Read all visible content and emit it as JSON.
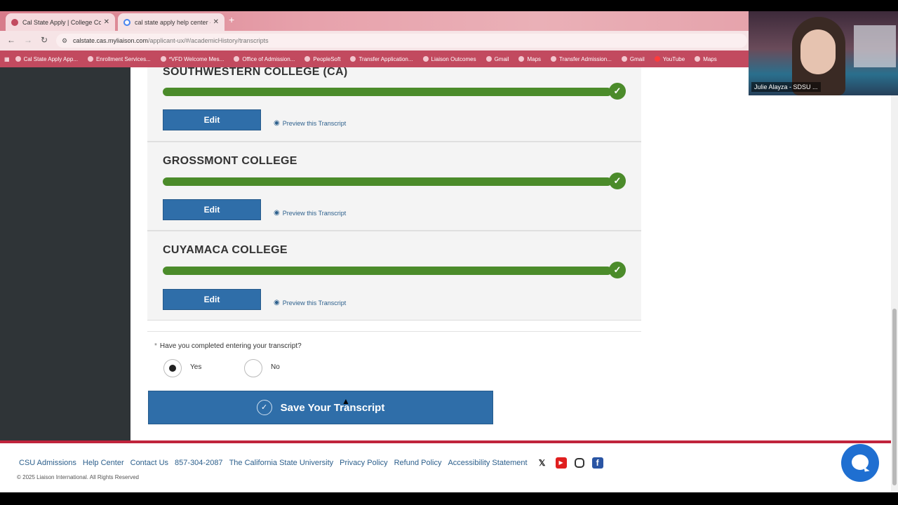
{
  "browser": {
    "tabs": [
      {
        "title": "Cal State Apply | College Cours",
        "active": true
      },
      {
        "title": "cal state apply help center - Go",
        "active": false
      }
    ],
    "url_host": "calstate.cas.myliaison.com",
    "url_path": "/applicant-ux/#/academicHistory/transcripts",
    "bookmarks": [
      "Cal State Apply App...",
      "Enrollment Services...",
      "*VFD Welcome Mes...",
      "Office of Admission...",
      "PeopleSoft",
      "Transfer Application...",
      "Liaison Outcomes",
      "Gmail",
      "Maps",
      "Transfer Admission...",
      "Gmail",
      "YouTube",
      "Maps"
    ]
  },
  "transcripts": [
    {
      "college": "SOUTHWESTERN COLLEGE (CA)",
      "edit_label": "Edit",
      "preview_label": "Preview this Transcript",
      "progress": 1.0
    },
    {
      "college": "GROSSMONT COLLEGE",
      "edit_label": "Edit",
      "preview_label": "Preview this Transcript",
      "progress": 1.0
    },
    {
      "college": "CUYAMACA COLLEGE",
      "edit_label": "Edit",
      "preview_label": "Preview this Transcript",
      "progress": 1.0
    }
  ],
  "question": {
    "text": "Have you completed entering your transcript?",
    "options": [
      "Yes",
      "No"
    ],
    "selected": "Yes"
  },
  "save_button": {
    "label": "Save Your Transcript"
  },
  "footer": {
    "links": [
      "CSU Admissions",
      "Help Center",
      "Contact Us",
      "857-304-2087",
      "The California State University",
      "Privacy Policy",
      "Refund Policy",
      "Accessibility Statement"
    ],
    "copyright": "© 2025 Liaison International. All Rights Reserved",
    "social_icons": [
      "x-icon",
      "youtube-icon",
      "instagram-icon",
      "facebook-icon"
    ]
  },
  "video": {
    "participant_name": "Julie Alayza - SDSU ..."
  },
  "colors": {
    "progress": "#4b8b2a",
    "primary": "#2f6ea9",
    "brand_red": "#c0243c"
  }
}
